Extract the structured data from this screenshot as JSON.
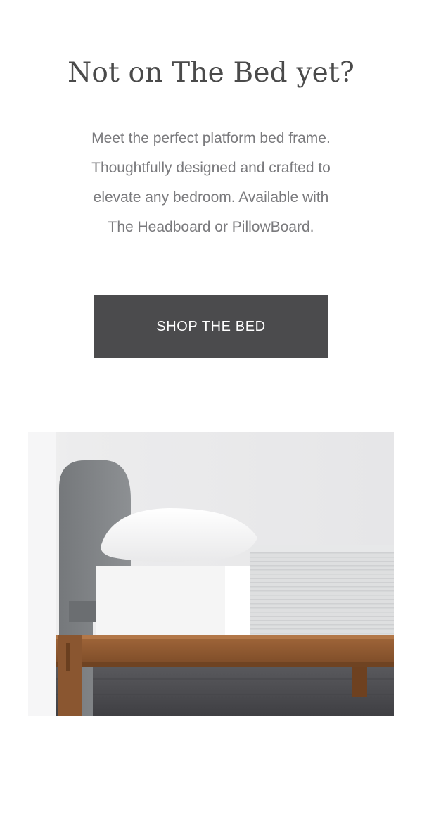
{
  "hero": {
    "headline": "Not on The Bed yet?",
    "body_lines": [
      "Meet the perfect platform bed frame.",
      "Thoughtfully designed and crafted to",
      "elevate any bedroom. Available with",
      "The Headboard or PillowBoard."
    ],
    "cta_label": "SHOP THE BED"
  },
  "colors": {
    "headline": "#4a4a4a",
    "body": "#7a7a7d",
    "cta_background": "#4b4b4d",
    "cta_text": "#ffffff"
  },
  "image": {
    "subject": "bed-frame-with-headboard-photo"
  }
}
